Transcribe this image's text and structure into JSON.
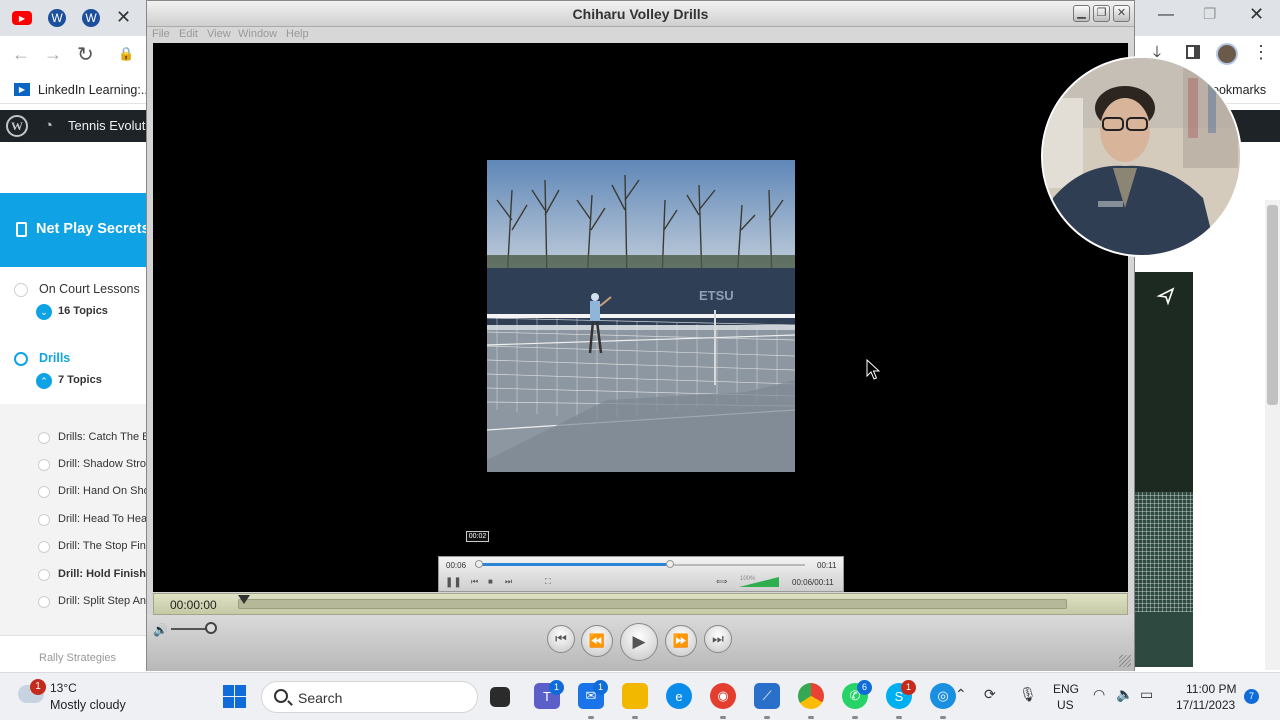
{
  "browser": {
    "bookmark_label": "LinkedIn Learning:...",
    "bookmarks_right": "ookmarks"
  },
  "wp_admin": {
    "site_name": "Tennis Evoluti"
  },
  "course": {
    "title": "Net Play Secrets",
    "lessons": [
      {
        "label": "On Court Lessons",
        "topics": "16 Topics"
      },
      {
        "label": "Drills",
        "topics": "7 Topics"
      }
    ],
    "topics": [
      "Drills: Catch The B",
      "Drill: Shadow Stro",
      "Drill: Hand On Sho",
      "Drill: Head To Hea",
      "Drill: The Stop Fin",
      "Drill: Hold Finish",
      "Drill: Split Step An"
    ],
    "next_lesson_partial": "Rally Strategies"
  },
  "player": {
    "title": "Chiharu Volley Drills",
    "menu": [
      "File",
      "Edit",
      "View",
      "Window",
      "Help"
    ],
    "tooltip": "00:02",
    "mini_current": "00:06",
    "mini_duration": "00:11",
    "mini_volume": "100%",
    "mini_time_combined": "00:06/00:11",
    "timecode": "00:00:00",
    "mini_progress": 0.6
  },
  "taskbar": {
    "weather_badge": "1",
    "temperature": "13°C",
    "weather": "Mostly cloudy",
    "search_placeholder": "Search",
    "teams_badge": "1",
    "mail_badge": "1",
    "whatsapp_badge": "6",
    "skype_badge": "1",
    "lang_line1": "ENG",
    "lang_line2": "US",
    "time": "11:00 PM",
    "date": "17/11/2023",
    "notifications": "7"
  },
  "colors": {
    "course_accent": "#0fa3e6",
    "wp_bar": "#1d2327",
    "progress_blue": "#2b84d6",
    "windows_blue": "#0f6cd8"
  }
}
